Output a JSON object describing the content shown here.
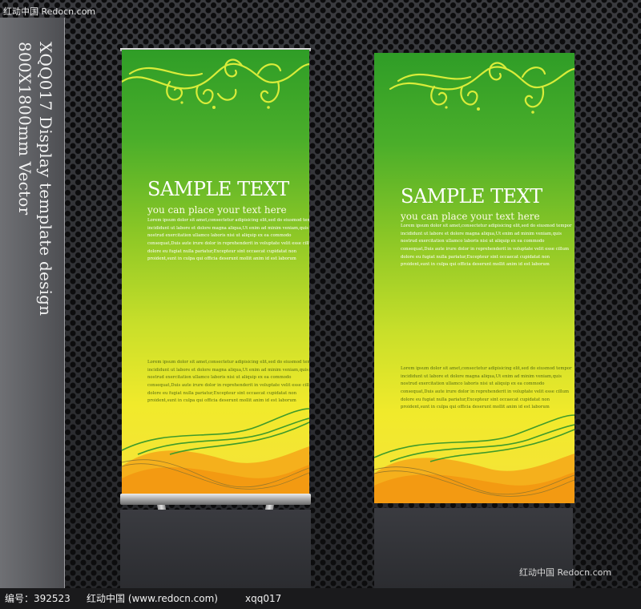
{
  "watermark_top": "红动中国 Redocn.com",
  "watermark_bottom": "红动中国 Redocn.com",
  "side_text": {
    "line1": "XQQ017 Display template design",
    "line2": "800X1800mm Vector"
  },
  "banners": [
    {
      "title": "SAMPLE TEXT",
      "subtitle": "you can place your text here",
      "body": [
        "Lorem ipsum dolor sit amet,consectetur adipisicing elit,sed do eiusmod tempor",
        "incididunt ut labore et dolore magna aliqua,Ut enim ad minim veniam,quis",
        "nostrud exercitation ullamco laboris nisi ut aliquip ex ea commodo",
        "consequat,Duis aute irure dolor in reprehenderit in voluptate velit esse cillum",
        "dolore eu fugiat nulla pariatur,Excepteur sint occaecat cupidatat non",
        "proident,sunt in culpa qui officia deserunt mollit anim id est laborum"
      ],
      "body2": [
        "Lorem ipsum dolor sit amet,consectetur adipisicing elit,sed do eiusmod tempor",
        "incididunt ut labore et dolore magna aliqua,Ut enim ad minim veniam,quis",
        "nostrud exercitation ullamco laboris nisi ut aliquip ex ea commodo",
        "consequat,Duis aute irure dolor in reprehenderit in voluptate velit esse cillum",
        "dolore eu fugiat nulla pariatur,Excepteur sint occaecat cupidatat non",
        "proident,sunt in culpa qui officia deserunt mollit anim id est laborum"
      ]
    },
    {
      "title": "SAMPLE TEXT",
      "subtitle": "you can place your text here",
      "body": [
        "Lorem ipsum dolor sit amet,consectetur adipisicing elit,sed do eiusmod tempor",
        "incididunt ut labore et dolore magna aliqua,Ut enim ad minim veniam,quis",
        "nostrud exercitation ullamco laboris nisi ut aliquip ex ea commodo",
        "consequat,Duis aute irure dolor in reprehenderit in voluptate velit esse cillum",
        "dolore eu fugiat nulla pariatur,Excepteur sint occaecat cupidatat non",
        "proident,sunt in culpa qui officia deserunt mollit anim id est laborum"
      ],
      "body2": [
        "Lorem ipsum dolor sit amet,consectetur adipisicing elit,sed do eiusmod tempor",
        "incididunt ut labore et dolore magna aliqua,Ut enim ad minim veniam,quis",
        "nostrud exercitation ullamco laboris nisi ut aliquip ex ea commodo",
        "consequat,Duis aute irure dolor in reprehenderit in voluptate velit esse cillum",
        "dolore eu fugiat nulla pariatur,Excepteur sint occaecat cupidatat non",
        "proident,sunt in culpa qui officia deserunt mollit anim id est laborum"
      ]
    }
  ],
  "footer": {
    "id": "编号：392523",
    "site": "红动中国 (www.redocn.com)",
    "code": "xqq017"
  },
  "colors": {
    "green": "#2f9d27",
    "yellow": "#f1ea2b",
    "orange": "#f39a12",
    "swirl": "#d9ec3a"
  }
}
